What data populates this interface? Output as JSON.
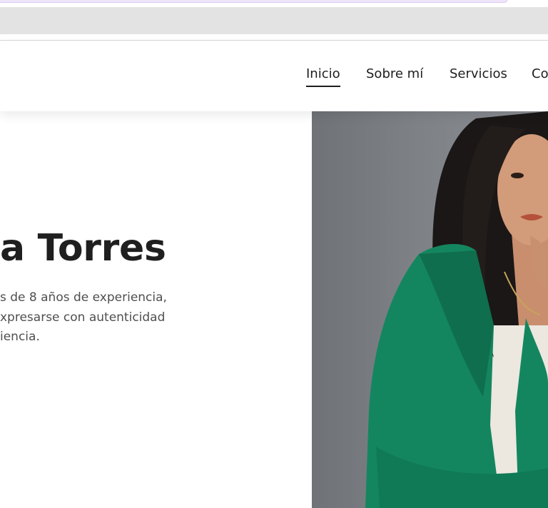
{
  "nav": {
    "items": [
      {
        "label": "Inicio",
        "active": true
      },
      {
        "label": "Sobre mí",
        "active": false
      },
      {
        "label": "Servicios",
        "active": false
      },
      {
        "label": "Co",
        "active": false
      }
    ]
  },
  "hero": {
    "title": "a Torres",
    "lines": [
      "s de 8 años de experiencia,",
      "xpresarse con autenticidad",
      "iencia."
    ]
  },
  "colors": {
    "jacket": "#14865f",
    "background_photo": "#7e8287",
    "text_dark": "#1f1f1f"
  }
}
